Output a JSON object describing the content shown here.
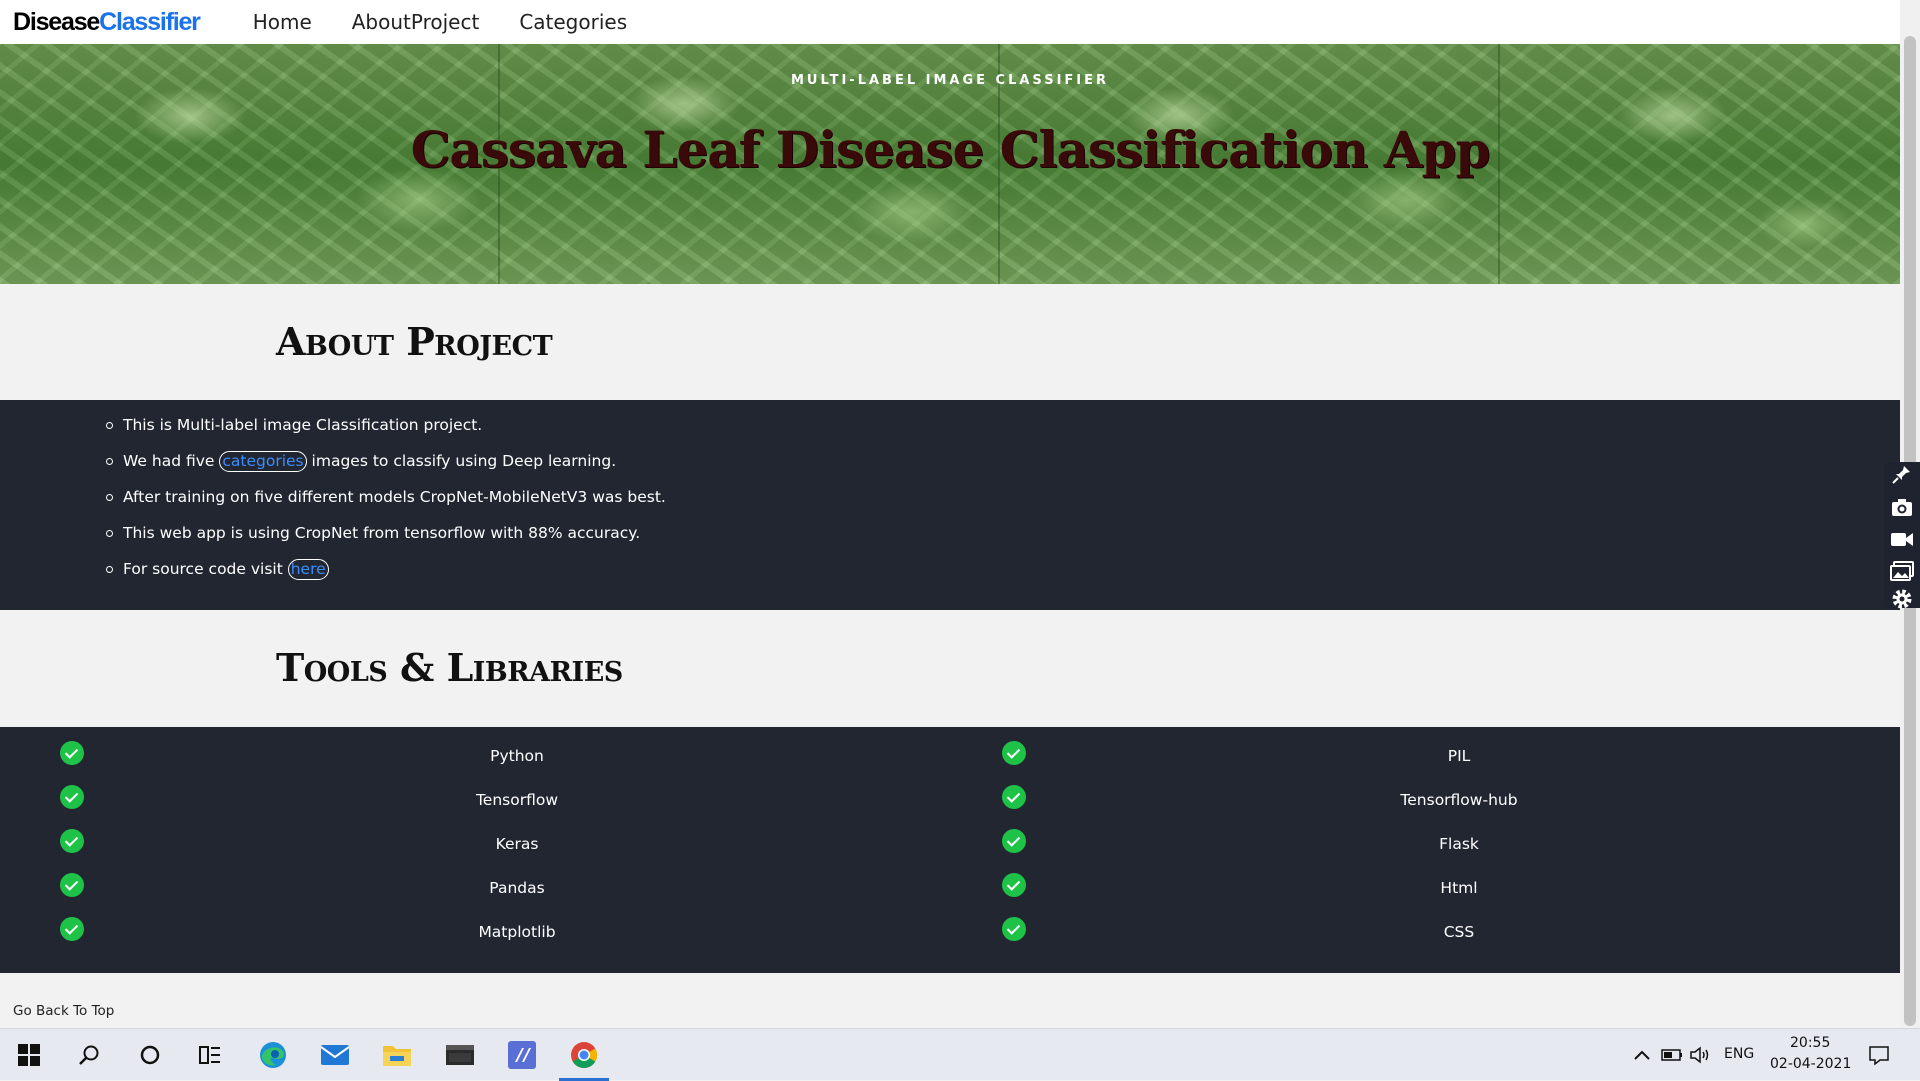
{
  "navbar": {
    "brand_part1": "Disease",
    "brand_part2": "Classifier",
    "links": [
      "Home",
      "AboutProject",
      "Categories"
    ]
  },
  "hero": {
    "subtitle": "MULTI-LABEL IMAGE CLASSIFIER",
    "title": "Cassava Leaf Disease Classification App"
  },
  "about": {
    "heading": "About Project",
    "items": [
      {
        "before": "This is Multi-label image Classification project.",
        "link": "",
        "after": ""
      },
      {
        "before": "We had five ",
        "link": "categories",
        "after": " images to classify using Deep learning."
      },
      {
        "before": "After training on five different models CropNet-MobileNetV3 was best.",
        "link": "",
        "after": ""
      },
      {
        "before": "This web app is using CropNet from tensorflow with 88% accuracy.",
        "link": "",
        "after": ""
      },
      {
        "before": "For source code visit ",
        "link": "here",
        "after": ""
      }
    ]
  },
  "tools": {
    "heading": "Tools & Libraries",
    "left": [
      "Python",
      "Tensorflow",
      "Keras",
      "Pandas",
      "Matplotlib"
    ],
    "right": [
      "PIL",
      "Tensorflow-hub",
      "Flask",
      "Html",
      "CSS"
    ]
  },
  "footer": {
    "back_to_top": "Go Back To Top"
  },
  "side_toolbar": {
    "icons": [
      "pin-icon",
      "camera-icon",
      "video-icon",
      "gallery-icon",
      "settings-icon"
    ]
  },
  "taskbar": {
    "apps": [
      "windows-start-icon",
      "search-icon",
      "cortana-icon",
      "task-view-icon",
      "edge-icon",
      "mail-icon",
      "file-explorer-icon",
      "terminal-icon",
      "vscode-icon",
      "chrome-icon"
    ],
    "language": "ENG",
    "time": "20:55",
    "date": "02-04-2021"
  },
  "colors": {
    "brand_accent": "#1a73e8",
    "dark_section": "#212631",
    "check_green": "#1ec247",
    "link_blue": "#3b8cff"
  }
}
